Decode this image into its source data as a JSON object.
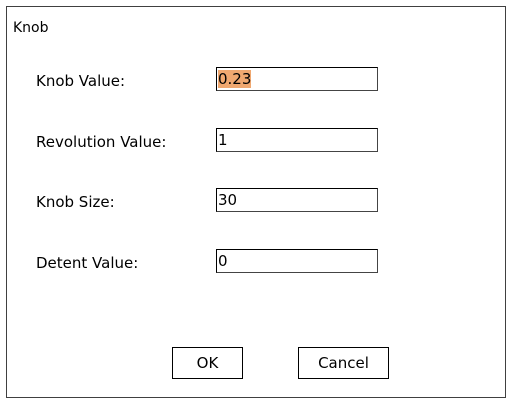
{
  "dialog": {
    "title": "Knob",
    "fields": [
      {
        "label": "Knob Value:",
        "value": "0.23"
      },
      {
        "label": "Revolution Value:",
        "value": "1"
      },
      {
        "label": "Knob Size:",
        "value": "30"
      },
      {
        "label": "Detent Value:",
        "value": "0"
      }
    ],
    "ok_label": "OK",
    "cancel_label": "Cancel"
  }
}
